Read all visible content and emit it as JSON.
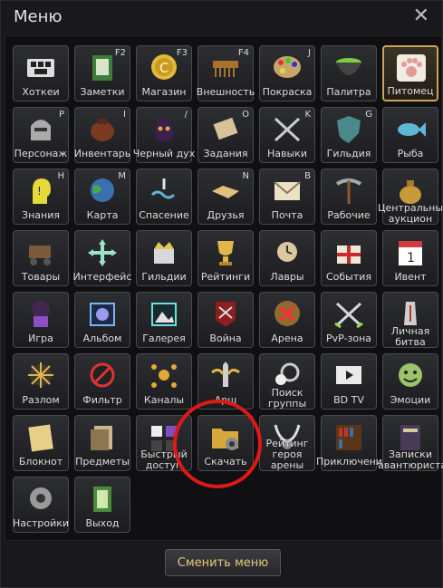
{
  "window": {
    "title": "Меню",
    "close_symbol": "✕"
  },
  "items": [
    {
      "label": "Хоткеи",
      "hotkey": "",
      "icon": "keyboard-icon"
    },
    {
      "label": "Заметки",
      "hotkey": "F2",
      "icon": "notes-icon"
    },
    {
      "label": "Магазин",
      "hotkey": "F3",
      "icon": "coin-icon"
    },
    {
      "label": "Внешность",
      "hotkey": "F4",
      "icon": "comb-icon"
    },
    {
      "label": "Покраска",
      "hotkey": "J",
      "icon": "palette-icon"
    },
    {
      "label": "Палитра",
      "hotkey": "",
      "icon": "dye-pot-icon"
    },
    {
      "label": "Питомец",
      "hotkey": "",
      "icon": "paw-icon"
    },
    {
      "label": "Персонаж",
      "hotkey": "P",
      "icon": "helmet-icon"
    },
    {
      "label": "Инвентарь",
      "hotkey": "I",
      "icon": "bag-icon"
    },
    {
      "label": "Черный дух",
      "hotkey": "/",
      "icon": "spirit-icon"
    },
    {
      "label": "Задания",
      "hotkey": "O",
      "icon": "scroll-icon"
    },
    {
      "label": "Навыки",
      "hotkey": "K",
      "icon": "swords-icon"
    },
    {
      "label": "Гильдия",
      "hotkey": "G",
      "icon": "shield-icon"
    },
    {
      "label": "Рыба",
      "hotkey": "",
      "icon": "fish-icon"
    },
    {
      "label": "Знания",
      "hotkey": "H",
      "icon": "head-icon"
    },
    {
      "label": "Карта",
      "hotkey": "M",
      "icon": "globe-icon"
    },
    {
      "label": "Спасение",
      "hotkey": "",
      "icon": "water-icon"
    },
    {
      "label": "Друзья",
      "hotkey": "N",
      "icon": "handshake-icon"
    },
    {
      "label": "Почта",
      "hotkey": "B",
      "icon": "mail-icon"
    },
    {
      "label": "Рабочие",
      "hotkey": "",
      "icon": "pickaxe-icon"
    },
    {
      "label": "Центральный аукцион",
      "hotkey": "",
      "icon": "money-bag-icon"
    },
    {
      "label": "Товары",
      "hotkey": "",
      "icon": "cart-icon"
    },
    {
      "label": "Интерфейс",
      "hotkey": "",
      "icon": "move-arrows-icon"
    },
    {
      "label": "Гильдии",
      "hotkey": "",
      "icon": "guild-crown-icon"
    },
    {
      "label": "Рейтинги",
      "hotkey": "",
      "icon": "trophy-icon"
    },
    {
      "label": "Лавры",
      "hotkey": "",
      "icon": "clock-laurel-icon"
    },
    {
      "label": "События",
      "hotkey": "",
      "icon": "gift-icon"
    },
    {
      "label": "Ивент",
      "hotkey": "",
      "icon": "calendar-icon"
    },
    {
      "label": "Игра",
      "hotkey": "",
      "icon": "dice-monster-icon"
    },
    {
      "label": "Альбом",
      "hotkey": "",
      "icon": "camera-icon"
    },
    {
      "label": "Галерея",
      "hotkey": "",
      "icon": "picture-icon"
    },
    {
      "label": "Война",
      "hotkey": "",
      "icon": "war-banner-icon"
    },
    {
      "label": "Арена",
      "hotkey": "",
      "icon": "arena-shield-icon"
    },
    {
      "label": "PvP-зона",
      "hotkey": "",
      "icon": "crossed-swords-icon"
    },
    {
      "label": "Личная битва",
      "hotkey": "",
      "icon": "duel-icon"
    },
    {
      "label": "Разлом",
      "hotkey": "",
      "icon": "rift-icon"
    },
    {
      "label": "Фильтр",
      "hotkey": "",
      "icon": "chat-block-icon"
    },
    {
      "label": "Каналы",
      "hotkey": "",
      "icon": "network-icon"
    },
    {
      "label": "Арш",
      "hotkey": "",
      "icon": "sword-wings-icon"
    },
    {
      "label": "Поиск группы",
      "hotkey": "",
      "icon": "magnifier-people-icon"
    },
    {
      "label": "BD TV",
      "hotkey": "",
      "icon": "tv-icon"
    },
    {
      "label": "Эмоции",
      "hotkey": "",
      "icon": "smile-icon"
    },
    {
      "label": "Блокнот",
      "hotkey": "",
      "icon": "notepad-icon"
    },
    {
      "label": "Предметы",
      "hotkey": "",
      "icon": "documents-icon"
    },
    {
      "label": "Быстрый доступ",
      "hotkey": "",
      "icon": "quick-slots-icon"
    },
    {
      "label": "Скачать",
      "hotkey": "",
      "icon": "folder-gear-icon"
    },
    {
      "label": "Рейтинг героя арены",
      "hotkey": "",
      "icon": "horns-icon"
    },
    {
      "label": "Приключения",
      "hotkey": "",
      "icon": "bookshelf-icon"
    },
    {
      "label": "Записки авантюриста",
      "hotkey": "",
      "icon": "journal-icon"
    },
    {
      "label": "Настройки",
      "hotkey": "",
      "icon": "gear-icon"
    },
    {
      "label": "Выход",
      "hotkey": "",
      "icon": "exit-door-icon"
    }
  ],
  "footer": {
    "switch_menu_label": "Сменить меню"
  },
  "active_item": "Питомец",
  "colors": {
    "accent": "#c8a653",
    "annotation": "#e01818"
  }
}
